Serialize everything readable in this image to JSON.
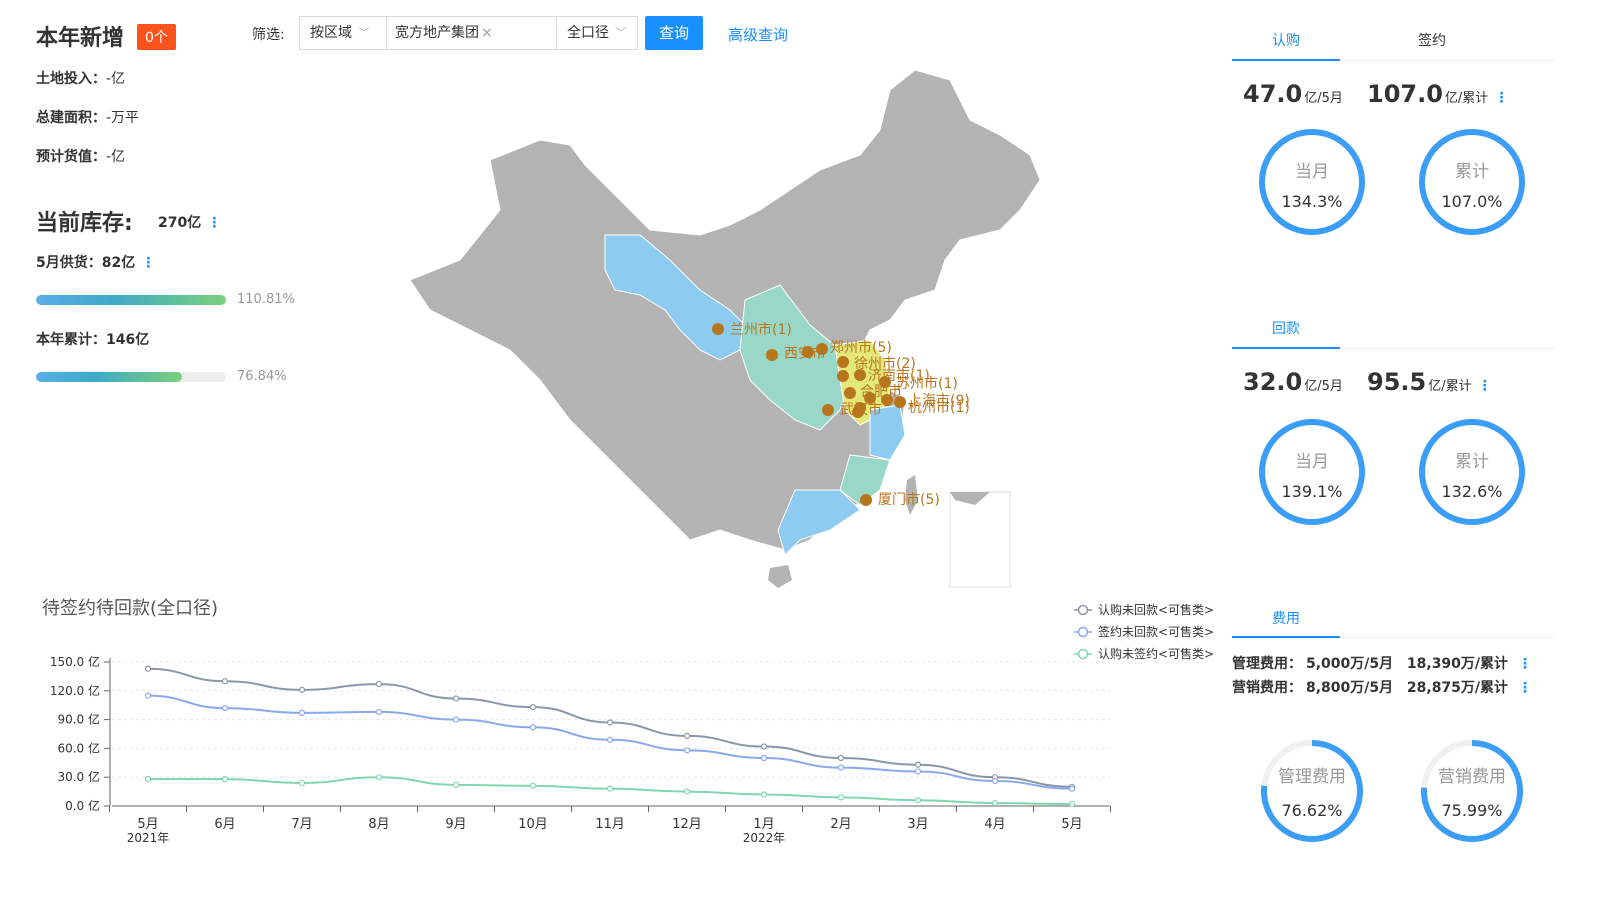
{
  "summary": {
    "new_title": "本年新增",
    "new_badge": "0个",
    "land_label": "土地投入：",
    "land_value": "-亿",
    "area_label": "总建面积：",
    "area_value": "-万平",
    "value_label": "预计货值：",
    "value_value": "-亿"
  },
  "inventory": {
    "title": "当前库存:",
    "value": "270亿",
    "monthly_label": "5月供货：",
    "monthly_value": "82亿",
    "monthly_pct": "110.81%",
    "monthly_fill": 1.0,
    "yearly_label": "本年累计：",
    "yearly_value": "146亿",
    "yearly_pct": "76.84%",
    "yearly_fill": 0.7684
  },
  "filter": {
    "label": "筛选:",
    "region": "按区域",
    "company": "宽方地产集团",
    "scope": "全口径",
    "query_btn": "查询",
    "advanced": "高级查询"
  },
  "map": {
    "cities": [
      {
        "name": "兰州市(1)"
      },
      {
        "name": "西安市"
      },
      {
        "name": "郑州市(5)"
      },
      {
        "name": "徐州市(2)"
      },
      {
        "name": "济南市(1)"
      },
      {
        "name": "合肥市"
      },
      {
        "name": "苏州市(1)"
      },
      {
        "name": "武汉市"
      },
      {
        "name": "杭州市(1)"
      },
      {
        "name": "上海市(9)"
      },
      {
        "name": "厦门市(5)"
      }
    ]
  },
  "subscription": {
    "tab_active": "认购",
    "tab_inactive": "签约",
    "month_value": "47.0",
    "month_unit": "亿/5月",
    "total_value": "107.0",
    "total_unit": "亿/累计",
    "ring_month_label": "当月",
    "ring_month_value": "134.3%",
    "ring_total_label": "累计",
    "ring_total_value": "107.0%"
  },
  "payment": {
    "tab": "回款",
    "month_value": "32.0",
    "month_unit": "亿/5月",
    "total_value": "95.5",
    "total_unit": "亿/累计",
    "ring_month_label": "当月",
    "ring_month_value": "139.1%",
    "ring_total_label": "累计",
    "ring_total_value": "132.6%"
  },
  "fees": {
    "tab": "费用",
    "mgmt_label": "管理费用：",
    "mgmt_month": "5,000万/5月",
    "mgmt_total": "18,390万/累计",
    "mkt_label": "营销费用：",
    "mkt_month": "8,800万/5月",
    "mkt_total": "28,875万/累计",
    "ring_mgmt_label": "管理费用",
    "ring_mgmt_value": "76.62%",
    "ring_mgmt_fill": 0.7662,
    "ring_mkt_label": "营销费用",
    "ring_mkt_value": "75.99%",
    "ring_mkt_fill": 0.7599
  },
  "colors": {
    "accent": "#1890ff",
    "badge": "#fa541c",
    "line1": "#8c96a8",
    "line2": "#8aa8f0",
    "line3": "#7fd6b0"
  },
  "chart_data": {
    "type": "line",
    "title": "待签约待回款(全口径)",
    "categories": [
      "5月",
      "6月",
      "7月",
      "8月",
      "9月",
      "10月",
      "11月",
      "12月",
      "1月",
      "2月",
      "3月",
      "4月",
      "5月"
    ],
    "year_labels": [
      {
        "index": 0,
        "label": "2021年"
      },
      {
        "index": 8,
        "label": "2022年"
      }
    ],
    "y_ticks": [
      "0.0 亿",
      "30.0 亿",
      "60.0 亿",
      "90.0 亿",
      "120.0 亿",
      "150.0 亿"
    ],
    "ylim": [
      0,
      150
    ],
    "series": [
      {
        "name": "认购未回款<可售类>",
        "values": [
          143,
          130,
          121,
          127,
          112,
          103,
          87,
          73,
          62,
          50,
          43,
          30,
          20
        ]
      },
      {
        "name": "签约未回款<可售类>",
        "values": [
          115,
          102,
          97,
          98,
          90,
          82,
          69,
          58,
          50,
          40,
          36,
          26,
          18
        ]
      },
      {
        "name": "认购未签约<可售类>",
        "values": [
          28,
          28,
          24,
          30,
          22,
          21,
          18,
          15,
          12,
          9,
          6,
          3,
          2
        ]
      }
    ]
  }
}
